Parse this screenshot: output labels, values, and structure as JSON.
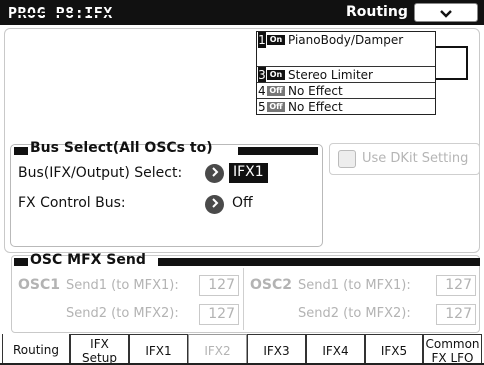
{
  "header": {
    "title": "PROG P8:IFX",
    "page_name": "Routing",
    "menu_icon": "chevron-down-icon"
  },
  "ifx_chain": {
    "slots": [
      {
        "num": "1",
        "state": "On",
        "name": "PianoBody/Damper"
      },
      {
        "num": "3",
        "state": "On",
        "name": "Stereo Limiter"
      },
      {
        "num": "4",
        "state": "Off",
        "name": "No Effect"
      },
      {
        "num": "5",
        "state": "Off",
        "name": "No Effect"
      }
    ]
  },
  "bus_select": {
    "title": "Bus Select(All OSCs to)",
    "bus_label": "Bus(IFX/Output) Select:",
    "bus_value": "IFX1",
    "fx_label": "FX Control Bus:",
    "fx_value": "Off"
  },
  "dkit": {
    "label": "Use DKit Setting"
  },
  "mfx_send": {
    "title": "OSC MFX Send",
    "osc1": {
      "name": "OSC1",
      "send1_label": "Send1 (to MFX1):",
      "send1": "127",
      "send2_label": "Send2 (to MFX2):",
      "send2": "127"
    },
    "osc2": {
      "name": "OSC2",
      "send1_label": "Send1 (to MFX1):",
      "send1": "127",
      "send2_label": "Send2 (to MFX2):",
      "send2": "127"
    }
  },
  "tabs": [
    {
      "line1": "Routing",
      "line2": ""
    },
    {
      "line1": "IFX",
      "line2": "Setup"
    },
    {
      "line1": "IFX1",
      "line2": ""
    },
    {
      "line1": "IFX2",
      "line2": ""
    },
    {
      "line1": "IFX3",
      "line2": ""
    },
    {
      "line1": "IFX4",
      "line2": ""
    },
    {
      "line1": "IFX5",
      "line2": ""
    },
    {
      "line1": "Common",
      "line2": "FX LFO"
    }
  ],
  "colors": {
    "background": "#ffffff",
    "ink": "#111111",
    "disabled": "#b3b3b3"
  }
}
